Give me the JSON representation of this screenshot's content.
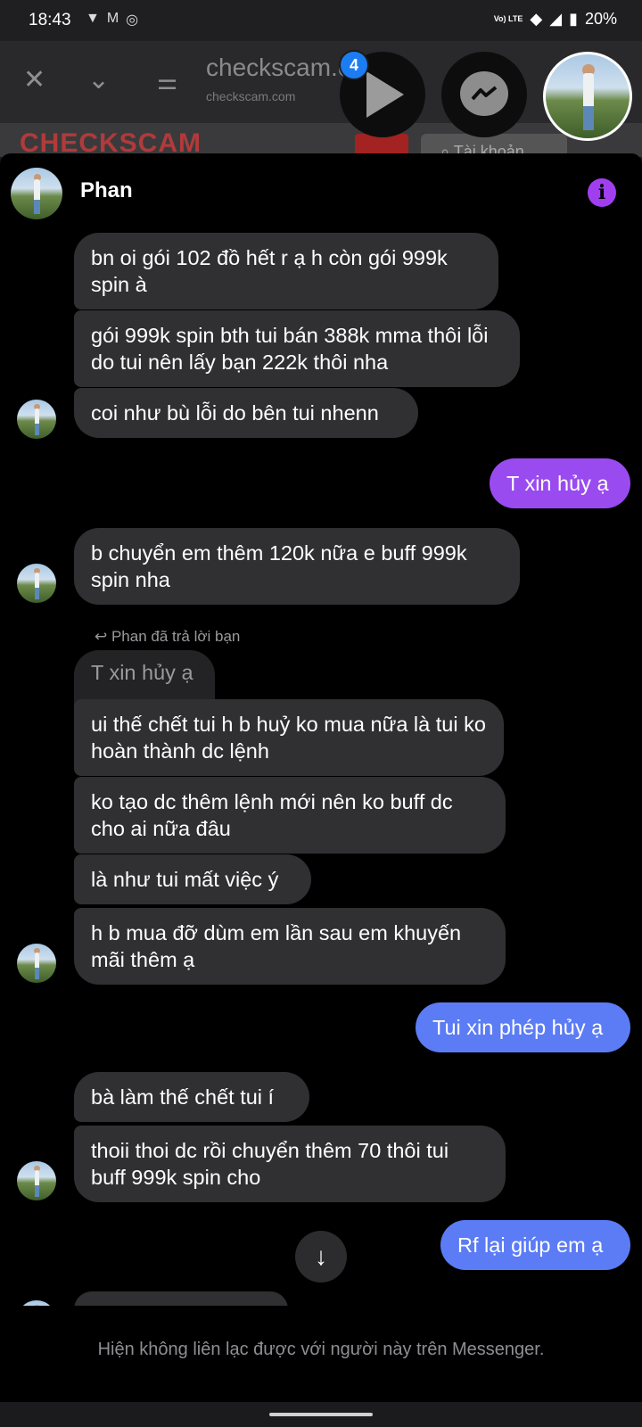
{
  "status_bar": {
    "time": "18:43",
    "battery": "20%",
    "lte": "Vo) LTE"
  },
  "browser": {
    "url_main": "checkscam.c",
    "url_ellipsis": "...",
    "url_sub": "checkscam.com",
    "site_logo": "CHECKSCAM",
    "site_search": "Tài khoản"
  },
  "chat_heads": {
    "badge_count": "4"
  },
  "conversation": {
    "contact_name": "Phan",
    "reply_note": "Phan đã trả lời bạn",
    "quoted": "T xin hủy ạ",
    "messages": [
      {
        "text": "bn oi gói 102 đồ hết r ạ h còn gói 999k spin à",
        "side": "in"
      },
      {
        "text": "gói 999k spin bth tui bán 388k mma thôi lỗi do tui nên lấy bạn 222k thôi nha",
        "side": "in"
      },
      {
        "text": "coi như bù lỗi do bên tui nhenn",
        "side": "in"
      },
      {
        "text": "T xin hủy ạ",
        "side": "out"
      },
      {
        "text": "b chuyển em thêm 120k nữa e buff 999k spin nha",
        "side": "in"
      },
      {
        "text": "ui thế chết tui h b huỷ ko mua nữa là tui ko hoàn thành dc lệnh",
        "side": "in"
      },
      {
        "text": "ko tạo dc thêm lệnh mới nên ko buff dc cho ai nữa đâu",
        "side": "in"
      },
      {
        "text": "là như tui mất việc ý",
        "side": "in"
      },
      {
        "text": "h b mua đỡ dùm em lần sau em khuyến mãi thêm ạ",
        "side": "in"
      },
      {
        "text": "Tui xin phép hủy ạ",
        "side": "out"
      },
      {
        "text": "bà làm thế chết tui í",
        "side": "in"
      },
      {
        "text": "thoii thoi dc rồi chuyển thêm 70 thôi tui buff 999k spin cho",
        "side": "in"
      },
      {
        "text": "Rf lại giúp em ạ",
        "side": "out"
      }
    ],
    "footer_notice": "Hiện không liên lạc được với người này trên Messenger."
  },
  "colors": {
    "outgoing_purple": "#9a4bf0",
    "outgoing_blue": "#5b7cf5",
    "incoming": "#303032",
    "info_icon": "#a13ff0"
  }
}
